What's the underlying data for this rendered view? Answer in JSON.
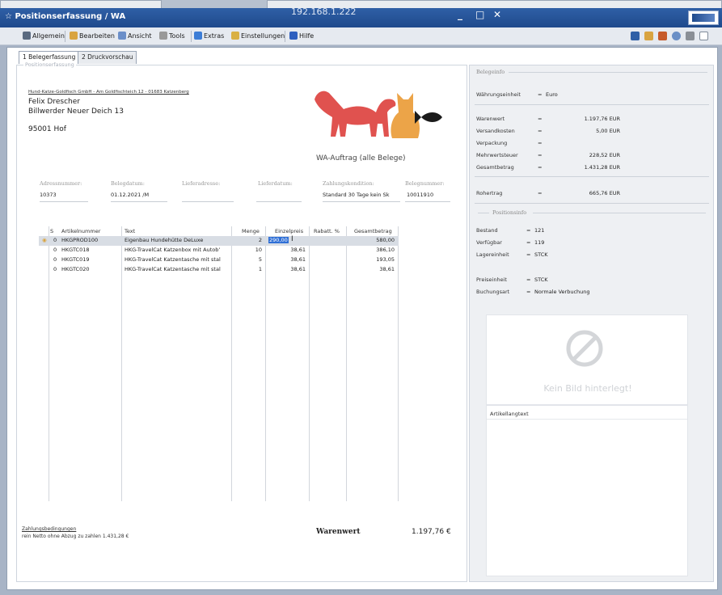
{
  "window": {
    "title": "Positionserfassung / WA",
    "ip": "192.168.1.222",
    "controls": [
      "_",
      "□",
      "✕"
    ]
  },
  "menu": [
    {
      "label": "Allgemein",
      "icon": "pin-icon",
      "color": "#5a6a80"
    },
    {
      "label": "Bearbeiten",
      "icon": "edit-icon",
      "color": "#d9a441"
    },
    {
      "label": "Ansicht",
      "icon": "view-icon",
      "color": "#6b8fc9"
    },
    {
      "label": "Tools",
      "icon": "tools-icon",
      "color": "#999999"
    },
    {
      "label": "Extras",
      "icon": "extras-icon",
      "color": "#3c7dd6"
    },
    {
      "label": "Einstellungen",
      "icon": "settings-icon",
      "color": "#d9b044"
    },
    {
      "label": "Hilfe",
      "icon": "help-icon",
      "color": "#2e5fbf"
    }
  ],
  "right_icons": [
    {
      "name": "pen-tool-icon",
      "color": "#2f5fa6"
    },
    {
      "name": "grid-tool-icon",
      "color": "#d9a441"
    },
    {
      "name": "export-tool-icon",
      "color": "#c65a2a"
    },
    {
      "name": "circle-tool-icon",
      "color": "#6a8fc6"
    },
    {
      "name": "printer-tool-icon",
      "color": "#8a8f96"
    },
    {
      "name": "window-tool-icon",
      "color": "#7f8a99"
    }
  ],
  "tabs": [
    "1 Belegerfassung",
    "2 Druckvorschau"
  ],
  "left": {
    "caption": "Positionserfassung",
    "sender_line": "Hund-Katze-Goldfisch GmbH - Am Goldfischteich 12 - 01683 Katzenberg",
    "recipient": {
      "name": "Felix Drescher",
      "street": "Billwerder Neuer Deich 13",
      "city": "95001 Hof"
    },
    "doc_type": "WA-Auftrag (alle Belege)",
    "fields": [
      {
        "label": "Adressnummer:",
        "value": "10373"
      },
      {
        "label": "Belegdatum:",
        "value": "01.12.2021 /M"
      },
      {
        "label": "Lieferadresse:",
        "value": ""
      },
      {
        "label": "Lieferdatum:",
        "value": ""
      },
      {
        "label": "Zahlungskondition:",
        "value": "Standard 30 Tage kein Sk"
      },
      {
        "label": "Belegnummer:",
        "value": "10011910"
      }
    ],
    "table": {
      "headers": [
        "S",
        "Artikelnummer",
        "Text",
        "Menge",
        "Einzelpreis",
        "Rabatt. %",
        "Gesamtbetrag"
      ],
      "rows": [
        {
          "s": "0",
          "art": "HKGPROD100",
          "text": "Eigenbau Hundehütte DeLuxe",
          "menge": "2",
          "preis": "290,00",
          "rabatt": "",
          "gesamt": "580,00"
        },
        {
          "s": "0",
          "art": "HKGTC018",
          "text": "HKG-TravelCat Katzenbox mit Autob’",
          "menge": "10",
          "preis": "38,61",
          "rabatt": "",
          "gesamt": "386,10"
        },
        {
          "s": "0",
          "art": "HKGTC019",
          "text": "HKG-TravelCat Katzentasche mit stal",
          "menge": "5",
          "preis": "38,61",
          "rabatt": "",
          "gesamt": "193,05"
        },
        {
          "s": "0",
          "art": "HKGTC020",
          "text": "HKG-TravelCat Katzentasche mit stal",
          "menge": "1",
          "preis": "38,61",
          "rabatt": "",
          "gesamt": "38,61"
        }
      ]
    },
    "footer": {
      "link": "Zahlungsbedingungen",
      "text": "rein Netto ohne Abzug zu zahlen 1.431,28 €",
      "warenwert_label": "Warenwert",
      "warenwert_value": "1.197,76 €"
    }
  },
  "right": {
    "belege_caption": "Belegeinfo",
    "waehrung_label": "Währungseinheit",
    "waehrung_eq": "=",
    "waehrung_value": "Euro",
    "sums": [
      {
        "label": "Warenwert",
        "value": "1.197,76 EUR"
      },
      {
        "label": "Versandkosten",
        "value": "5,00 EUR"
      },
      {
        "label": "Verpackung",
        "value": ""
      },
      {
        "label": "Mehrwertsteuer",
        "value": "228,52 EUR"
      },
      {
        "label": "Gesamtbetrag",
        "value": "1.431,28 EUR"
      }
    ],
    "rohertrag_label": "Rohertrag",
    "rohertrag_value": "665,76 EUR",
    "pos_caption": "Positionsinfo",
    "pos": [
      {
        "label": "Bestand",
        "value": "121"
      },
      {
        "label": "Verfügbar",
        "value": "119"
      },
      {
        "label": "Lagereinheit",
        "value": "STCK"
      },
      {
        "label": "Preiseinheit",
        "value": "STCK"
      },
      {
        "label": "Buchungsart",
        "value": "Normale Verbuchung"
      }
    ],
    "no_image": "Kein Bild hinterlegt!",
    "artikellangtext": "Artikellangtext"
  }
}
